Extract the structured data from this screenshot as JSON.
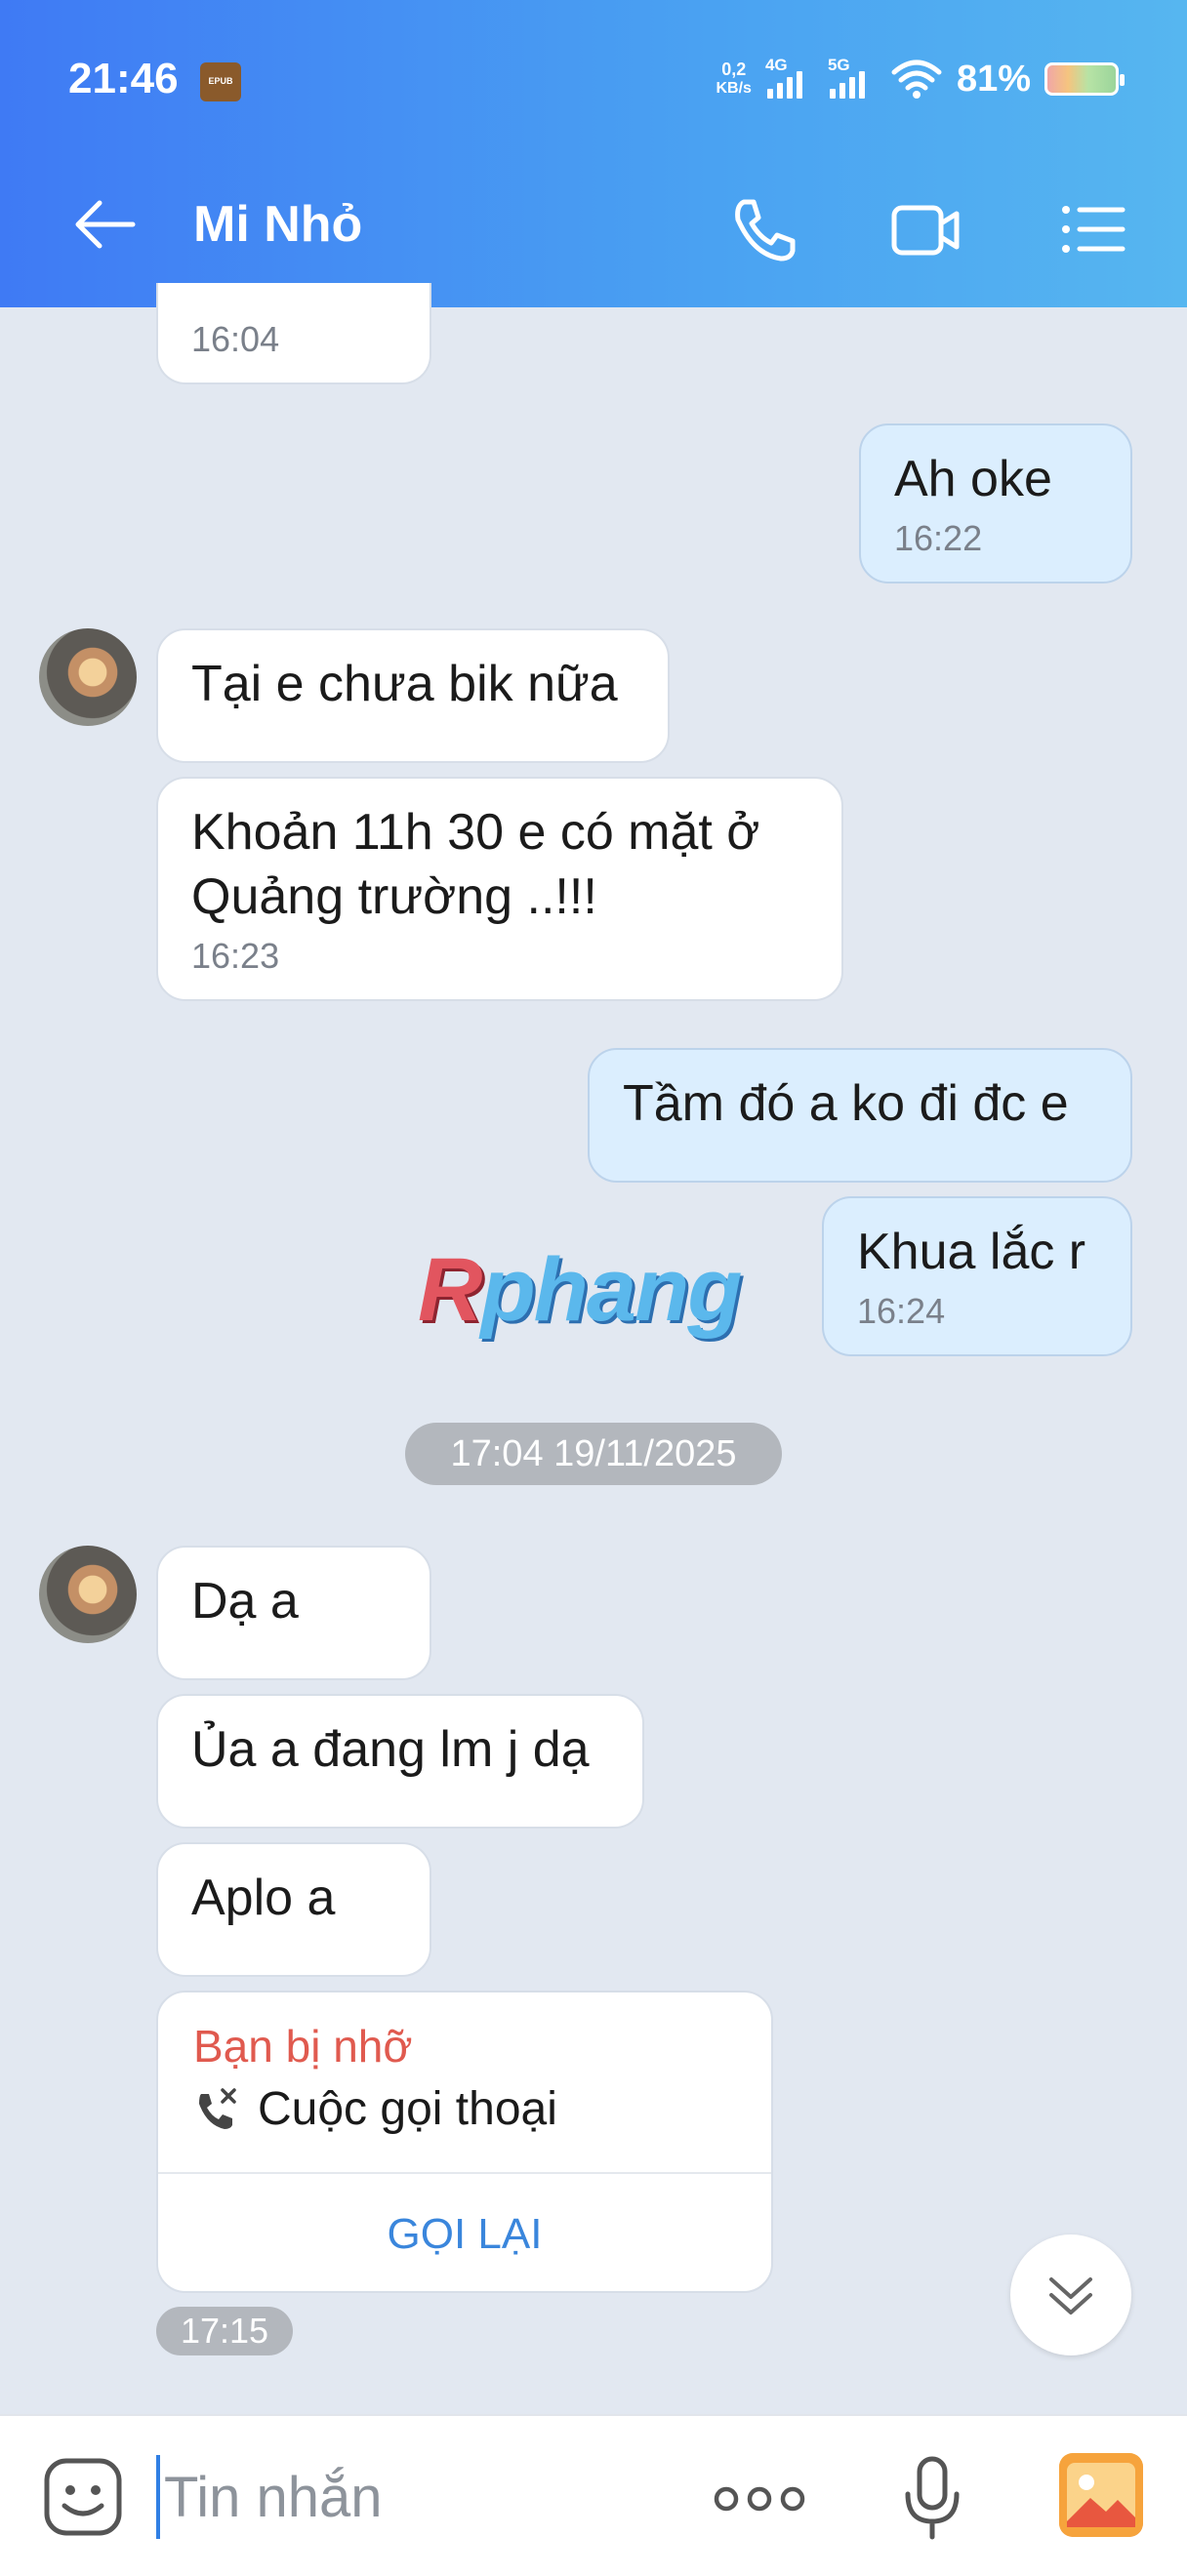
{
  "status_bar": {
    "time": "21:46",
    "app_badge": "EPUB",
    "net_speed_value": "0,2",
    "net_speed_unit": "KB/s",
    "sim1_label": "4G",
    "sim2_label": "5G",
    "battery_percent": "81%"
  },
  "header": {
    "title": "Mi Nhỏ",
    "icons": [
      "back-arrow-icon",
      "phone-icon",
      "video-camera-icon",
      "menu-list-icon"
    ]
  },
  "messages": [
    {
      "side": "theirs",
      "text": "",
      "time": "16:04"
    },
    {
      "side": "mine",
      "text": "Ah oke",
      "time": "16:22"
    },
    {
      "side": "theirs",
      "text": "Tại e chưa bik nữa",
      "time": ""
    },
    {
      "side": "theirs",
      "text": "Khoản 11h 30 e có mặt ở Quảng trường ..!!!",
      "time": "16:23"
    },
    {
      "side": "mine",
      "text": "Tầm đó a ko đi đc e",
      "time": ""
    },
    {
      "side": "mine",
      "text": "Khua lắc r",
      "time": "16:24"
    },
    {
      "side": "theirs",
      "text": "Dạ a",
      "time": ""
    },
    {
      "side": "theirs",
      "text": "Ủa a đang lm j dạ",
      "time": ""
    },
    {
      "side": "theirs",
      "text": "Aplo a",
      "time": ""
    }
  ],
  "date_divider": "17:04 19/11/2025",
  "watermark": {
    "r": "R",
    "rest": "phang"
  },
  "missed_call": {
    "title": "Bạn bị nhỡ",
    "subtitle": "Cuộc gọi thoại",
    "action": "GỌI LẠI",
    "time": "17:15"
  },
  "input": {
    "placeholder": "Tin nhắn"
  },
  "colors": {
    "header_start": "#3f7af4",
    "header_end": "#56b6f0",
    "my_bubble": "#dbeefe",
    "missed_red": "#e05a4f",
    "action_blue": "#3a86dc"
  }
}
